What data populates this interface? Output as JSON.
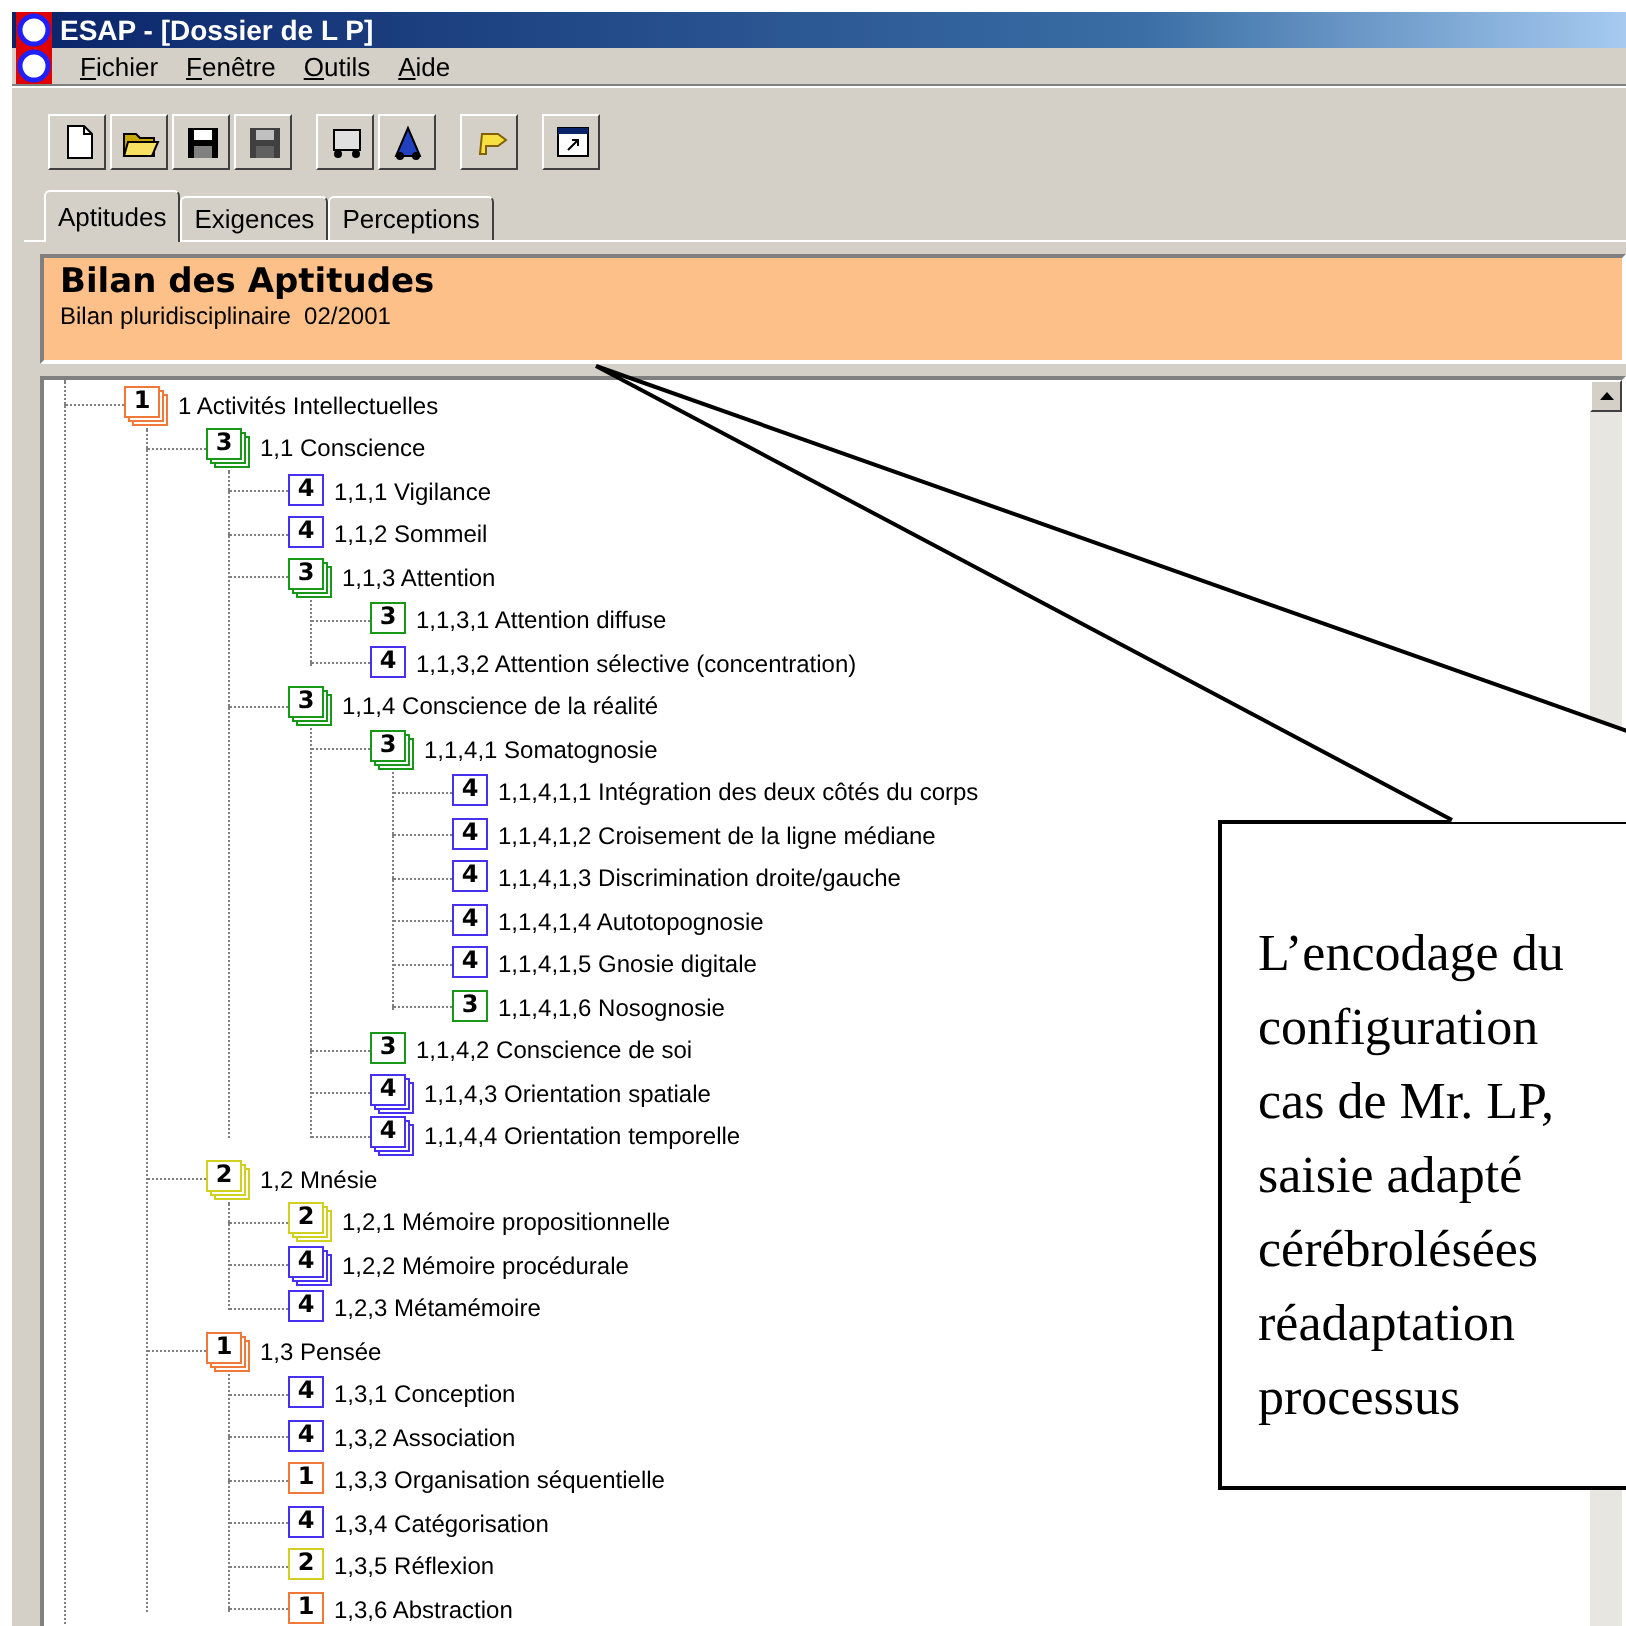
{
  "window": {
    "title": "ESAP - [Dossier de L P]"
  },
  "menu": [
    "Fichier",
    "Fenêtre",
    "Outils",
    "Aide"
  ],
  "tabs": [
    {
      "label": "Aptitudes",
      "selected": true
    },
    {
      "label": "Exigences",
      "selected": false
    },
    {
      "label": "Perceptions",
      "selected": false
    }
  ],
  "header": {
    "title": "Bilan des Aptitudes",
    "subtitle": "Bilan pluridisciplinaire  02/2001"
  },
  "tree": [
    {
      "score": "1",
      "kind": "group",
      "color": "#f07838",
      "label": "1 Activités Intellectuelles",
      "children": [
        {
          "score": "3",
          "kind": "group",
          "color": "#189818",
          "label": "1,1 Conscience",
          "children": [
            {
              "score": "4",
              "kind": "single",
              "color": "#4830f0",
              "label": "1,1,1 Vigilance"
            },
            {
              "score": "4",
              "kind": "single",
              "color": "#4830f0",
              "label": "1,1,2 Sommeil"
            },
            {
              "score": "3",
              "kind": "group",
              "color": "#189818",
              "label": "1,1,3 Attention",
              "children": [
                {
                  "score": "3",
                  "kind": "single",
                  "color": "#189818",
                  "label": "1,1,3,1 Attention diffuse"
                },
                {
                  "score": "4",
                  "kind": "single",
                  "color": "#4830f0",
                  "label": "1,1,3,2 Attention sélective (concentration)"
                }
              ]
            },
            {
              "score": "3",
              "kind": "group",
              "color": "#189818",
              "label": "1,1,4 Conscience de la réalité",
              "children": [
                {
                  "score": "3",
                  "kind": "group",
                  "color": "#189818",
                  "label": "1,1,4,1 Somatognosie",
                  "children": [
                    {
                      "score": "4",
                      "kind": "single",
                      "color": "#4830f0",
                      "label": "1,1,4,1,1 Intégration des deux côtés du corps"
                    },
                    {
                      "score": "4",
                      "kind": "single",
                      "color": "#4830f0",
                      "label": "1,1,4,1,2 Croisement de la ligne médiane"
                    },
                    {
                      "score": "4",
                      "kind": "single",
                      "color": "#4830f0",
                      "label": "1,1,4,1,3 Discrimination droite/gauche"
                    },
                    {
                      "score": "4",
                      "kind": "single",
                      "color": "#4830f0",
                      "label": "1,1,4,1,4 Autotopognosie"
                    },
                    {
                      "score": "4",
                      "kind": "single",
                      "color": "#4830f0",
                      "label": "1,1,4,1,5 Gnosie digitale"
                    },
                    {
                      "score": "3",
                      "kind": "single",
                      "color": "#189818",
                      "label": "1,1,4,1,6 Nosognosie"
                    }
                  ]
                },
                {
                  "score": "3",
                  "kind": "single",
                  "color": "#189818",
                  "label": "1,1,4,2 Conscience de soi"
                },
                {
                  "score": "4",
                  "kind": "group",
                  "color": "#4830f0",
                  "label": "1,1,4,3 Orientation spatiale"
                },
                {
                  "score": "4",
                  "kind": "group",
                  "color": "#4830f0",
                  "label": "1,1,4,4 Orientation temporelle"
                }
              ]
            }
          ]
        },
        {
          "score": "2",
          "kind": "group",
          "color": "#d0d020",
          "label": "1,2 Mnésie",
          "children": [
            {
              "score": "2",
              "kind": "group",
              "color": "#d0d020",
              "label": "1,2,1 Mémoire propositionnelle"
            },
            {
              "score": "4",
              "kind": "group",
              "color": "#4830f0",
              "label": "1,2,2 Mémoire procédurale"
            },
            {
              "score": "4",
              "kind": "single",
              "color": "#4830f0",
              "label": "1,2,3 Métamémoire"
            }
          ]
        },
        {
          "score": "1",
          "kind": "group",
          "color": "#f07838",
          "label": "1,3 Pensée",
          "children": [
            {
              "score": "4",
              "kind": "single",
              "color": "#4830f0",
              "label": "1,3,1 Conception"
            },
            {
              "score": "4",
              "kind": "single",
              "color": "#4830f0",
              "label": "1,3,2 Association"
            },
            {
              "score": "1",
              "kind": "single",
              "color": "#f07838",
              "label": "1,3,3 Organisation séquentielle"
            },
            {
              "score": "4",
              "kind": "single",
              "color": "#4830f0",
              "label": "1,3,4 Catégorisation"
            },
            {
              "score": "2",
              "kind": "single",
              "color": "#d0d020",
              "label": "1,3,5 Réflexion"
            },
            {
              "score": "1",
              "kind": "single",
              "color": "#f07838",
              "label": "1,3,6 Abstraction"
            }
          ]
        }
      ]
    }
  ],
  "callout": {
    "lines": [
      "L’encodage du",
      "configuration",
      "cas de Mr. LP,",
      "saisie adapté",
      "cérébrolésées",
      "réadaptation",
      "processus"
    ]
  }
}
